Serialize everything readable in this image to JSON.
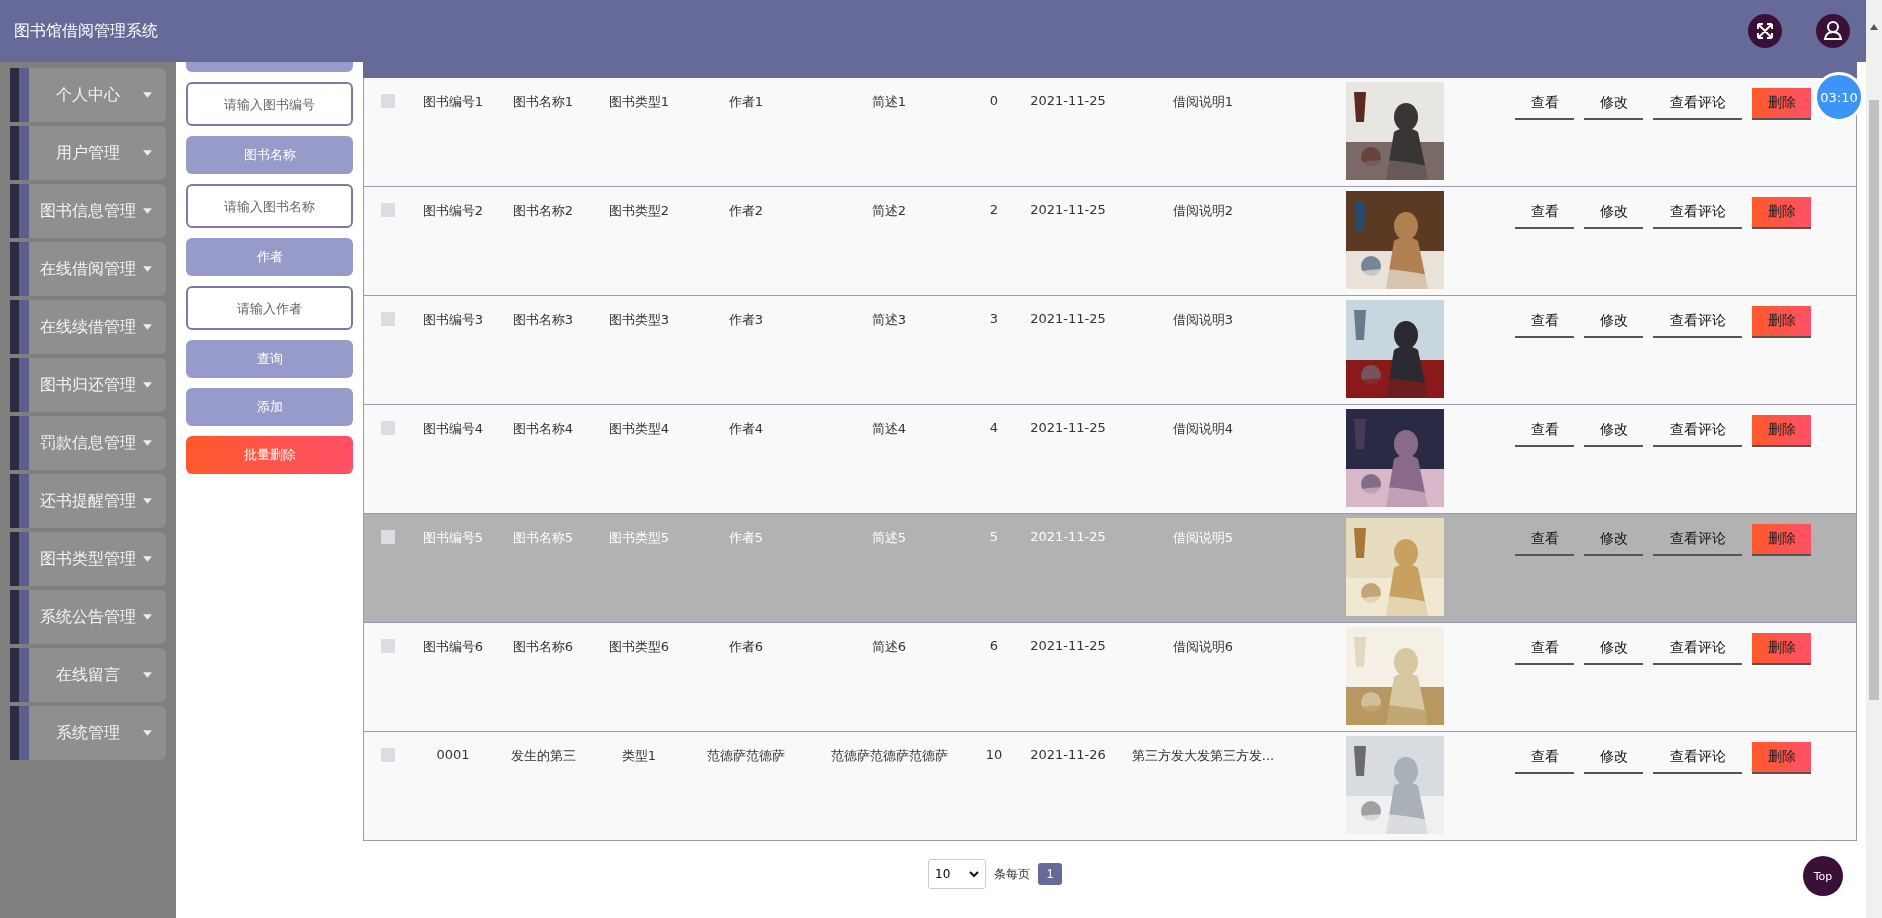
{
  "header": {
    "title": "图书馆借阅管理系统"
  },
  "sidebar": {
    "items": [
      {
        "label": "个人中心"
      },
      {
        "label": "用户管理"
      },
      {
        "label": "图书信息管理"
      },
      {
        "label": "在线借阅管理"
      },
      {
        "label": "在线续借管理"
      },
      {
        "label": "图书归还管理"
      },
      {
        "label": "罚款信息管理"
      },
      {
        "label": "还书提醒管理"
      },
      {
        "label": "图书类型管理"
      },
      {
        "label": "系统公告管理"
      },
      {
        "label": "在线留言"
      },
      {
        "label": "系统管理"
      }
    ]
  },
  "search_panel": {
    "controls": [
      {
        "kind": "stub"
      },
      {
        "kind": "input",
        "placeholder": "请输入图书编号"
      },
      {
        "kind": "label",
        "text": "图书名称"
      },
      {
        "kind": "input",
        "placeholder": "请输入图书名称"
      },
      {
        "kind": "label",
        "text": "作者"
      },
      {
        "kind": "input",
        "placeholder": "请输入作者"
      },
      {
        "kind": "button",
        "text": "查询"
      },
      {
        "kind": "button",
        "text": "添加"
      },
      {
        "kind": "danger",
        "text": "批量删除"
      }
    ]
  },
  "table": {
    "rows": [
      {
        "checked": false,
        "highlighted": false,
        "cells": [
          "图书编号1",
          "图书名称1",
          "图书类型1",
          "作者1",
          "简述1",
          "0",
          "2021-11-25",
          "借阅说明1"
        ],
        "cover": {
          "kind": "picture"
        },
        "actions": [
          {
            "kind": "link",
            "text": "查看"
          },
          {
            "kind": "link",
            "text": "修改"
          },
          {
            "kind": "link",
            "text": "查看评论"
          },
          {
            "kind": "danger",
            "text": "删除"
          }
        ]
      },
      {
        "checked": false,
        "highlighted": false,
        "cells": [
          "图书编号2",
          "图书名称2",
          "图书类型2",
          "作者2",
          "简述2",
          "2",
          "2021-11-25",
          "借阅说明2"
        ],
        "cover": {
          "kind": "picture"
        },
        "actions": [
          {
            "kind": "link",
            "text": "查看"
          },
          {
            "kind": "link",
            "text": "修改"
          },
          {
            "kind": "link",
            "text": "查看评论"
          },
          {
            "kind": "danger",
            "text": "删除"
          }
        ]
      },
      {
        "checked": false,
        "highlighted": false,
        "cells": [
          "图书编号3",
          "图书名称3",
          "图书类型3",
          "作者3",
          "简述3",
          "3",
          "2021-11-25",
          "借阅说明3"
        ],
        "cover": {
          "kind": "picture"
        },
        "actions": [
          {
            "kind": "link",
            "text": "查看"
          },
          {
            "kind": "link",
            "text": "修改"
          },
          {
            "kind": "link",
            "text": "查看评论"
          },
          {
            "kind": "danger",
            "text": "删除"
          }
        ]
      },
      {
        "checked": false,
        "highlighted": false,
        "cells": [
          "图书编号4",
          "图书名称4",
          "图书类型4",
          "作者4",
          "简述4",
          "4",
          "2021-11-25",
          "借阅说明4"
        ],
        "cover": {
          "kind": "picture"
        },
        "actions": [
          {
            "kind": "link",
            "text": "查看"
          },
          {
            "kind": "link",
            "text": "修改"
          },
          {
            "kind": "link",
            "text": "查看评论"
          },
          {
            "kind": "danger",
            "text": "删除"
          }
        ]
      },
      {
        "checked": false,
        "highlighted": true,
        "cells": [
          "图书编号5",
          "图书名称5",
          "图书类型5",
          "作者5",
          "简述5",
          "5",
          "2021-11-25",
          "借阅说明5"
        ],
        "cover": {
          "kind": "picture"
        },
        "actions": [
          {
            "kind": "link",
            "text": "查看"
          },
          {
            "kind": "link",
            "text": "修改"
          },
          {
            "kind": "link",
            "text": "查看评论"
          },
          {
            "kind": "danger",
            "text": "删除"
          }
        ]
      },
      {
        "checked": false,
        "highlighted": false,
        "cells": [
          "图书编号6",
          "图书名称6",
          "图书类型6",
          "作者6",
          "简述6",
          "6",
          "2021-11-25",
          "借阅说明6"
        ],
        "cover": {
          "kind": "picture"
        },
        "actions": [
          {
            "kind": "link",
            "text": "查看"
          },
          {
            "kind": "link",
            "text": "修改"
          },
          {
            "kind": "link",
            "text": "查看评论"
          },
          {
            "kind": "danger",
            "text": "删除"
          }
        ]
      },
      {
        "checked": false,
        "highlighted": false,
        "cells": [
          "0001",
          "发生的第三",
          "类型1",
          "范德萨范德萨",
          "范德萨范德萨范德萨",
          "10",
          "2021-11-26",
          "第三方发大发第三方发..."
        ],
        "cover": {
          "kind": "picture"
        },
        "actions": [
          {
            "kind": "link",
            "text": "查看"
          },
          {
            "kind": "link",
            "text": "修改"
          },
          {
            "kind": "link",
            "text": "查看评论"
          },
          {
            "kind": "danger",
            "text": "删除"
          }
        ]
      }
    ]
  },
  "pagination": {
    "page_size": "10",
    "page_size_label": "条每页",
    "pages": [
      {
        "label": "1",
        "selected": true
      }
    ]
  },
  "timer": "03:10",
  "back_to_top": "Top"
}
